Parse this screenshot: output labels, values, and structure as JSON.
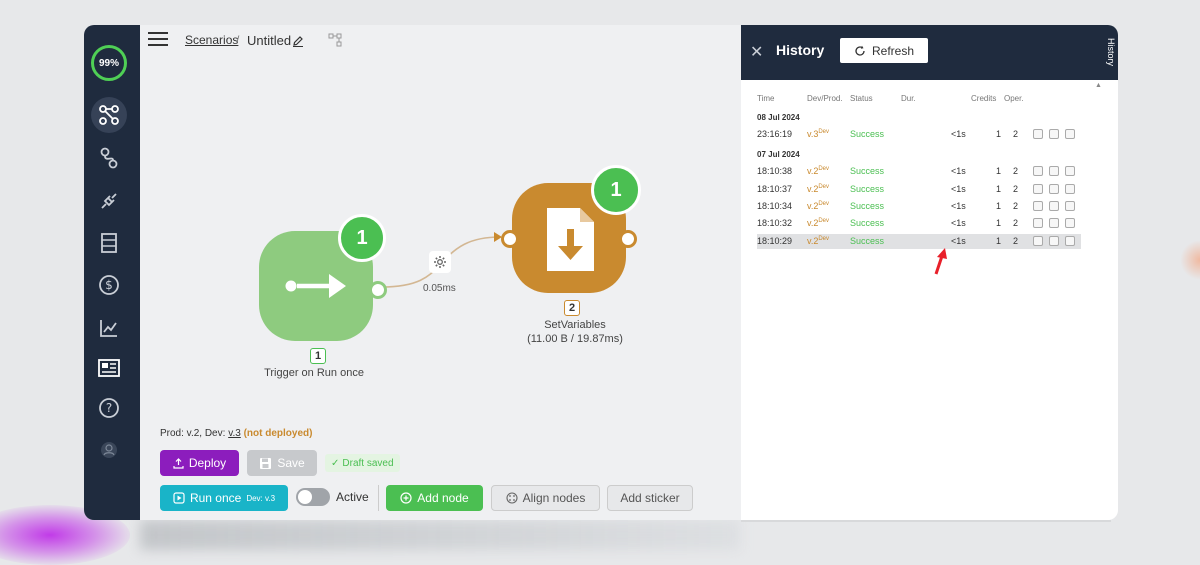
{
  "sidebar": {
    "progress": "99%"
  },
  "breadcrumb": {
    "link": "Scenarios",
    "sep": "/",
    "title": "Untitled"
  },
  "canvas": {
    "trigger": {
      "badge": "1",
      "num": "1",
      "label": "Trigger on Run once"
    },
    "setvars": {
      "badge": "1",
      "num": "2",
      "label": "SetVariables",
      "sub": "(11.00 B / 19.87ms)"
    },
    "connection": {
      "label": "0.05ms"
    }
  },
  "footer": {
    "ver_prefix": "Prod: v.2, Dev:",
    "ver_dev": "v.3",
    "ver_warn": "(not deployed)",
    "deploy": "Deploy",
    "save": "Save",
    "draft": "Draft saved",
    "run": "Run once",
    "run_sup": "Dev: v.3",
    "active": "Active",
    "add_node": "Add node",
    "align": "Align nodes",
    "sticker": "Add sticker"
  },
  "history": {
    "title": "History",
    "refresh": "Refresh",
    "tab": "History",
    "columns": [
      "Time",
      "Dev/Prod.",
      "Status",
      "Dur.",
      "Credits",
      "Oper."
    ],
    "groups": [
      {
        "date": "08 Jul 2024",
        "rows": [
          {
            "time": "23:16:19",
            "ver": "v.3",
            "env": "Dev",
            "status": "Success",
            "dur": "<1s",
            "credits": "1",
            "oper": "2"
          }
        ]
      },
      {
        "date": "07 Jul 2024",
        "rows": [
          {
            "time": "18:10:38",
            "ver": "v.2",
            "env": "Dev",
            "status": "Success",
            "dur": "<1s",
            "credits": "1",
            "oper": "2"
          },
          {
            "time": "18:10:37",
            "ver": "v.2",
            "env": "Dev",
            "status": "Success",
            "dur": "<1s",
            "credits": "1",
            "oper": "2"
          },
          {
            "time": "18:10:34",
            "ver": "v.2",
            "env": "Dev",
            "status": "Success",
            "dur": "<1s",
            "credits": "1",
            "oper": "2"
          },
          {
            "time": "18:10:32",
            "ver": "v.2",
            "env": "Dev",
            "status": "Success",
            "dur": "<1s",
            "credits": "1",
            "oper": "2"
          },
          {
            "time": "18:10:29",
            "ver": "v.2",
            "env": "Dev",
            "status": "Success",
            "dur": "<1s",
            "credits": "1",
            "oper": "2"
          }
        ]
      }
    ]
  },
  "colors": {
    "sidebar": "#1f2b3e",
    "success": "#4bbf52",
    "deploy": "#8c1dbd",
    "run": "#19b4c8",
    "setvars": "#c98a2f",
    "trigger": "#8ecb7f"
  }
}
